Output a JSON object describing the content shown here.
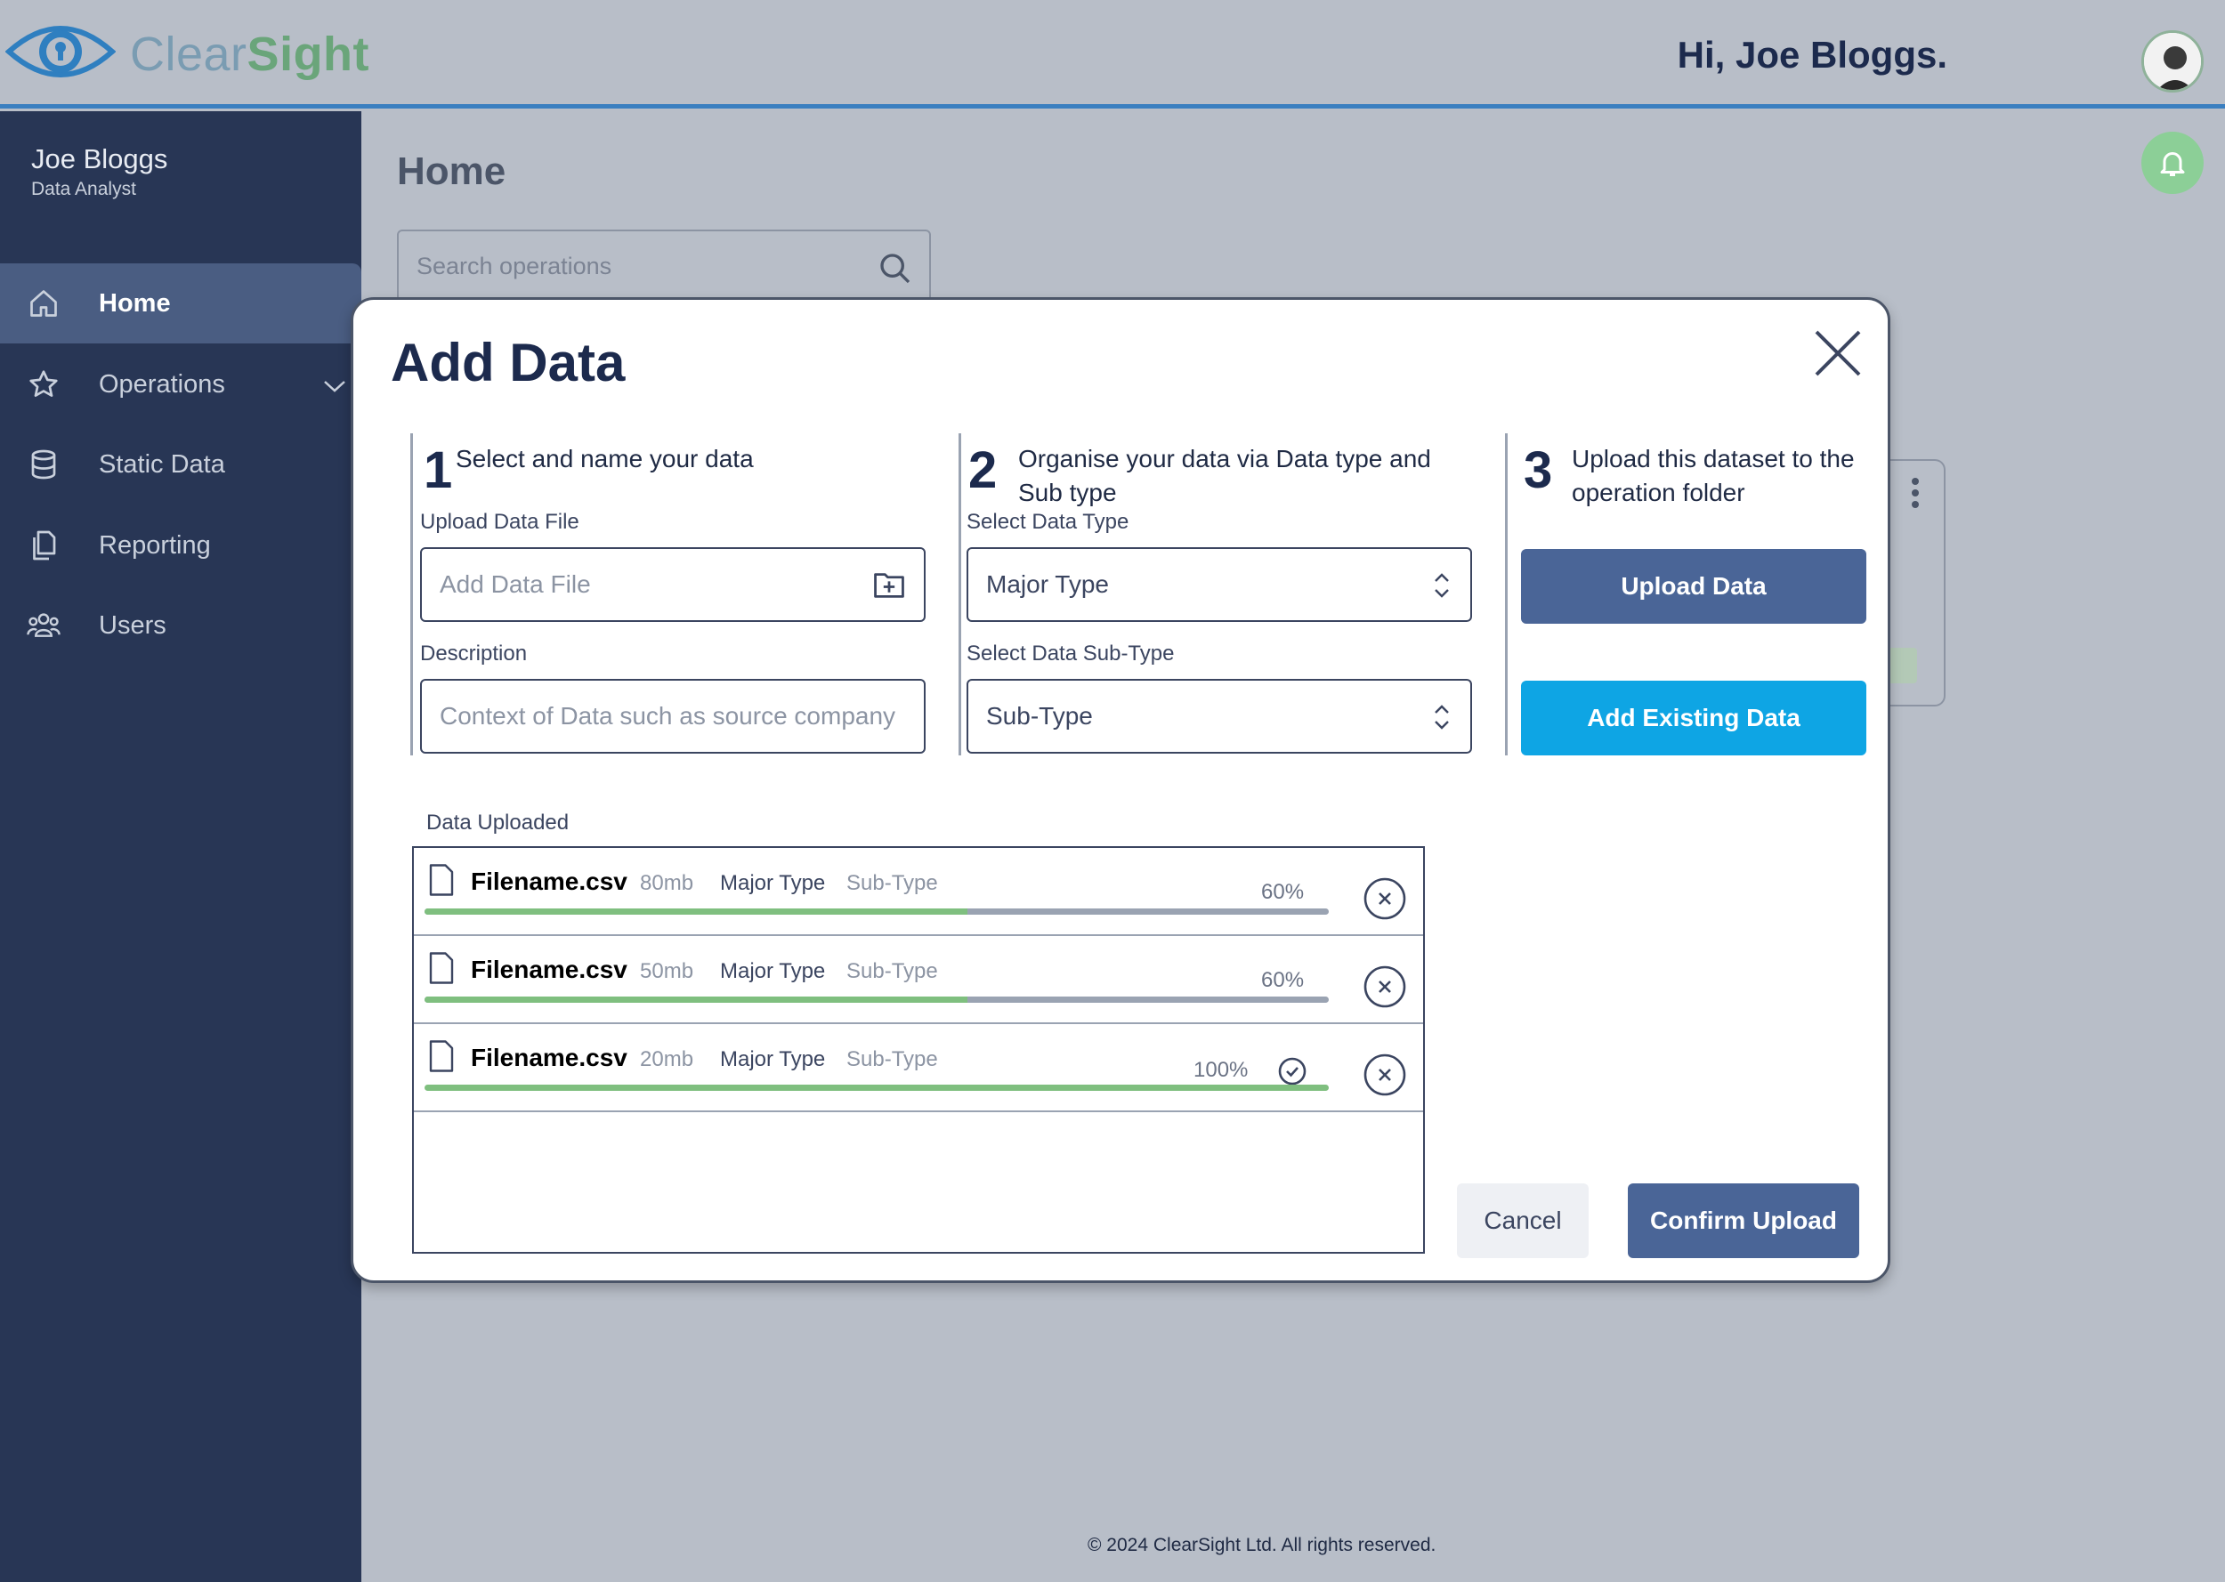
{
  "header": {
    "brand_clear": "Clear",
    "brand_sight": "Sight",
    "greeting": "Hi, Joe Bloggs."
  },
  "sidebar": {
    "user_name": "Joe Bloggs",
    "user_role": "Data Analyst",
    "items": [
      {
        "label": "Home",
        "icon": "home-icon",
        "active": true
      },
      {
        "label": "Operations",
        "icon": "star-icon",
        "active": false
      },
      {
        "label": "Static Data",
        "icon": "database-icon",
        "active": false
      },
      {
        "label": "Reporting",
        "icon": "documents-icon",
        "active": false
      },
      {
        "label": "Users",
        "icon": "users-icon",
        "active": false
      }
    ]
  },
  "main": {
    "title": "Home",
    "search_placeholder": "Search operations",
    "footer": "© 2024 ClearSight Ltd. All rights reserved."
  },
  "modal": {
    "title": "Add Data",
    "steps": [
      {
        "num": "1",
        "text": "Select and name your data"
      },
      {
        "num": "2",
        "text": "Organise your data via Data type and Sub type"
      },
      {
        "num": "3",
        "text": "Upload this dataset to the operation folder"
      }
    ],
    "upload_file_label": "Upload Data File",
    "upload_file_placeholder": "Add Data File",
    "description_label": "Description",
    "description_placeholder": "Context of Data such as source company",
    "data_type_label": "Select Data Type",
    "data_type_value": "Major Type",
    "sub_type_label": "Select Data Sub-Type",
    "sub_type_value": "Sub-Type",
    "upload_button": "Upload Data",
    "existing_button": "Add Existing Data",
    "uploaded_label": "Data Uploaded",
    "files": [
      {
        "name": "Filename.csv",
        "size": "80mb",
        "type": "Major Type",
        "subtype": "Sub-Type",
        "progress": "60%",
        "progress_fraction": 0.6,
        "complete": false
      },
      {
        "name": "Filename.csv",
        "size": "50mb",
        "type": "Major Type",
        "subtype": "Sub-Type",
        "progress": "60%",
        "progress_fraction": 0.6,
        "complete": false
      },
      {
        "name": "Filename.csv",
        "size": "20mb",
        "type": "Major Type",
        "subtype": "Sub-Type",
        "progress": "100%",
        "progress_fraction": 1.0,
        "complete": true
      }
    ],
    "cancel_button": "Cancel",
    "confirm_button": "Confirm Upload"
  },
  "colors": {
    "sidebar_bg": "#283655",
    "primary_button": "#4a6597",
    "accent_button": "#0ea5e4",
    "progress_fill": "#7fbf7f",
    "topbar_border": "#3a7fc0"
  }
}
